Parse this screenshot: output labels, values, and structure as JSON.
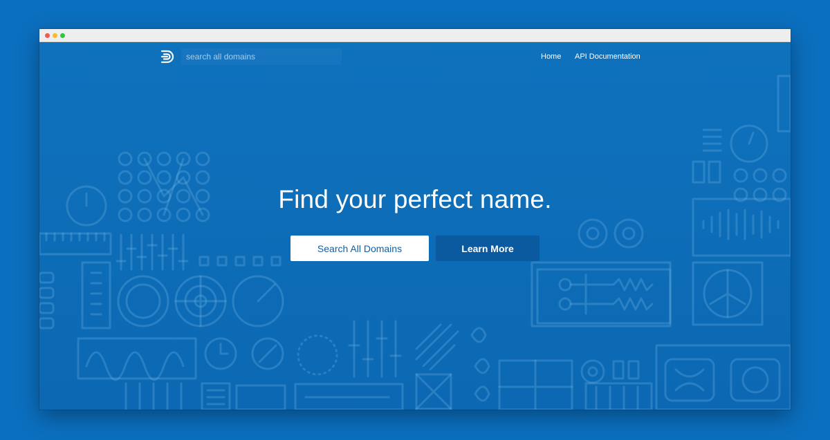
{
  "nav": {
    "search_placeholder": "search all domains",
    "links": [
      {
        "label": "Home"
      },
      {
        "label": "API Documentation"
      }
    ]
  },
  "hero": {
    "title": "Find your perfect name.",
    "primary_button": "Search All Domains",
    "secondary_button": "Learn More"
  },
  "colors": {
    "background": "#0b6fbf",
    "hero_blue": "#0f72bd",
    "button_text": "#0f5ea8",
    "secondary_button": "#0b5aa0"
  }
}
